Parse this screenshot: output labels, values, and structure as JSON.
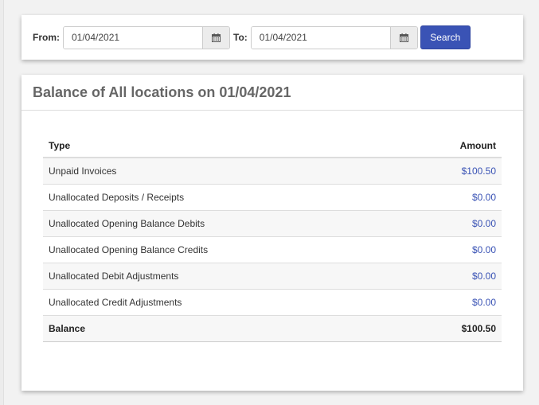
{
  "filter": {
    "from_label": "From:",
    "from_value": "01/04/2021",
    "to_label": "To:",
    "to_value": "01/04/2021",
    "search_label": "Search",
    "calendar_icon": "calendar-icon"
  },
  "report": {
    "title": "Balance of All locations on 01/04/2021",
    "columns": {
      "type": "Type",
      "amount": "Amount"
    },
    "rows": [
      {
        "type": "Unpaid Invoices",
        "amount": "$100.50"
      },
      {
        "type": "Unallocated Deposits / Receipts",
        "amount": "$0.00"
      },
      {
        "type": "Unallocated Opening Balance Debits",
        "amount": "$0.00"
      },
      {
        "type": "Unallocated Opening Balance Credits",
        "amount": "$0.00"
      },
      {
        "type": "Unallocated Debit Adjustments",
        "amount": "$0.00"
      },
      {
        "type": "Unallocated Credit Adjustments",
        "amount": "$0.00"
      }
    ],
    "total": {
      "type": "Balance",
      "amount": "$100.50"
    }
  },
  "colors": {
    "accent": "#3a53b5",
    "link": "#3a53b5",
    "title": "#666666"
  }
}
